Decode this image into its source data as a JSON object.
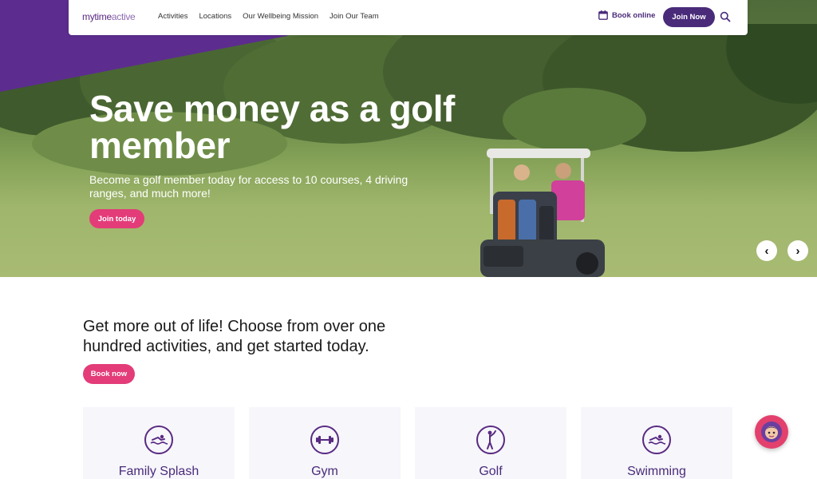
{
  "nav": {
    "logo_main": "mytime",
    "logo_accent": "active",
    "links": [
      "Activities",
      "Locations",
      "Our Wellbeing Mission",
      "Join Our Team"
    ],
    "book_online": "Book online",
    "join_now": "Join Now",
    "search_icon": "search-icon",
    "calendar_icon": "calendar-icon"
  },
  "hero": {
    "title": "Save money as a golf member",
    "subtitle": "Become a golf member today for access to 10 courses, 4 driving ranges, and much more!",
    "cta": "Join today",
    "prev": "‹",
    "next": "›"
  },
  "intro": {
    "text": "Get more out of life! Choose from over one hundred activities, and get started today.",
    "cta": "Book now"
  },
  "cards": [
    {
      "label": "Family Splash",
      "icon": "swimmer-icon"
    },
    {
      "label": "Gym",
      "icon": "dumbbell-icon"
    },
    {
      "label": "Golf",
      "icon": "golfer-icon"
    },
    {
      "label": "Swimming",
      "icon": "swimmer-icon"
    }
  ],
  "colors": {
    "brand_purple": "#4a2b7a",
    "accent_pink": "#e33c79"
  }
}
